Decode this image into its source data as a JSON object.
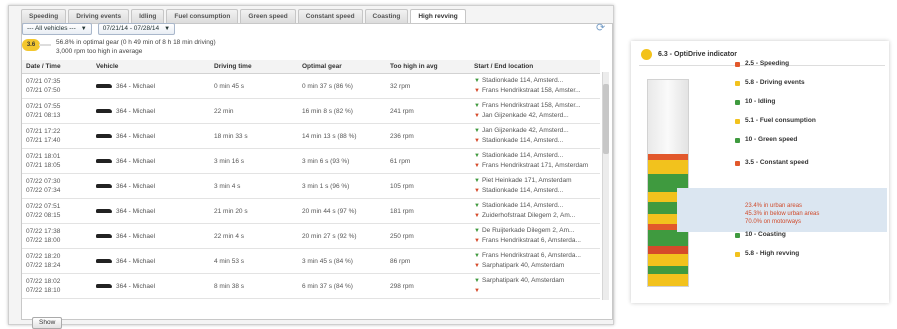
{
  "tabs": [
    "Speeding",
    "Driving events",
    "Idling",
    "Fuel consumption",
    "Green speed",
    "Constant speed",
    "Coasting",
    "High revving"
  ],
  "active_tab": "High revving",
  "filters": {
    "vehicles": "--- All vehicles ---",
    "date_range": "07/21/14 - 07/28/14"
  },
  "summary": {
    "score": "3.6",
    "line1": "56.8% in optimal gear (0 h 49 min of 8 h 18 min driving)",
    "line2": "3,000 rpm too high in average"
  },
  "table": {
    "columns": [
      "Date / Time",
      "Vehicle",
      "Driving time",
      "Optimal gear",
      "Too high in avg",
      "Start / End location"
    ],
    "rows": [
      {
        "datetime": [
          "07/21 07:35",
          "07/21 07:50"
        ],
        "vehicle": "364 - Michael",
        "driving_time": "0 min 45 s",
        "optimal_gear": "0 min 37 s (86 %)",
        "too_high": "32 rpm",
        "locations": [
          "Stadionkade 114, Amsterd...",
          "Frans Hendrikstraat 158, Amster..."
        ]
      },
      {
        "datetime": [
          "07/21 07:55",
          "07/21 08:13"
        ],
        "vehicle": "364 - Michael",
        "driving_time": "22 min",
        "optimal_gear": "16 min 8 s (82 %)",
        "too_high": "241 rpm",
        "locations": [
          "Frans Hendrikstraat 158, Amster...",
          "Jan Gijzenkade 42, Amsterd..."
        ]
      },
      {
        "datetime": [
          "07/21 17:22",
          "07/21 17:40"
        ],
        "vehicle": "364 - Michael",
        "driving_time": "18 min 33 s",
        "optimal_gear": "14 min 13 s (88 %)",
        "too_high": "236 rpm",
        "locations": [
          "Jan Gijzenkade 42, Amsterd...",
          "Stadionkade 114, Amsterd..."
        ]
      },
      {
        "datetime": [
          "07/21 18:01",
          "07/21 18:05"
        ],
        "vehicle": "364 - Michael",
        "driving_time": "3 min 16 s",
        "optimal_gear": "3 min 6 s (93 %)",
        "too_high": "61 rpm",
        "locations": [
          "Stadionkade 114, Amsterd...",
          "Frans Hendrikstraat 171, Amsterdam"
        ]
      },
      {
        "datetime": [
          "07/22 07:30",
          "07/22 07:34"
        ],
        "vehicle": "364 - Michael",
        "driving_time": "3 min 4 s",
        "optimal_gear": "3 min 1 s (96 %)",
        "too_high": "105 rpm",
        "locations": [
          "Piet Heinkade 171, Amsterdam",
          "Stadionkade 114, Amsterd..."
        ]
      },
      {
        "datetime": [
          "07/22 07:51",
          "07/22 08:15"
        ],
        "vehicle": "364 - Michael",
        "driving_time": "21 min 20 s",
        "optimal_gear": "20 min 44 s (97 %)",
        "too_high": "181 rpm",
        "locations": [
          "Stadionkade 114, Amsterd...",
          "Zuiderhofstraat Dilegem 2, Am..."
        ]
      },
      {
        "datetime": [
          "07/22 17:38",
          "07/22 18:00"
        ],
        "vehicle": "364 - Michael",
        "driving_time": "22 min 4 s",
        "optimal_gear": "20 min 27 s (92 %)",
        "too_high": "250 rpm",
        "locations": [
          "De Ruijterkade Dilegem 2, Am...",
          "Frans Hendrikstraat 6, Amsterda..."
        ]
      },
      {
        "datetime": [
          "07/22 18:20",
          "07/22 18:24"
        ],
        "vehicle": "364 - Michael",
        "driving_time": "4 min 53 s",
        "optimal_gear": "3 min 45 s (84 %)",
        "too_high": "86 rpm",
        "locations": [
          "Frans Hendrikstraat 6, Amsterda...",
          "Sarphatipark 40, Amsterdam"
        ]
      },
      {
        "datetime": [
          "07/22 18:02",
          "07/22 18:10"
        ],
        "vehicle": "364 - Michael",
        "driving_time": "8 min 38 s",
        "optimal_gear": "6 min 37 s (84 %)",
        "too_high": "298 rpm",
        "locations": [
          "Sarphatipark 40, Amsterdam",
          ""
        ]
      }
    ]
  },
  "show_button": "Show",
  "optidrive": {
    "title": "6.3 - OptiDrive indicator",
    "items": [
      {
        "score": "2.5",
        "label": "Speeding",
        "color": "#e2582b"
      },
      {
        "score": "5.8",
        "label": "Driving events",
        "color": "#f2c21d"
      },
      {
        "score": "10",
        "label": "Idling",
        "color": "#3f9a3f"
      },
      {
        "score": "5.1",
        "label": "Fuel consumption",
        "color": "#f2c21d"
      },
      {
        "score": "10",
        "label": "Green speed",
        "color": "#3f9a3f"
      },
      {
        "score": "3.5",
        "label": "Constant speed",
        "color": "#e2582b"
      },
      {
        "score": "10",
        "label": "Coasting",
        "color": "#3f9a3f"
      },
      {
        "score": "5.8",
        "label": "High revving",
        "color": "#f2c21d"
      }
    ],
    "constant_speed_details": [
      "23.4% in urban areas",
      "45.3% in below urban areas",
      "70.0% on motorways"
    ]
  }
}
